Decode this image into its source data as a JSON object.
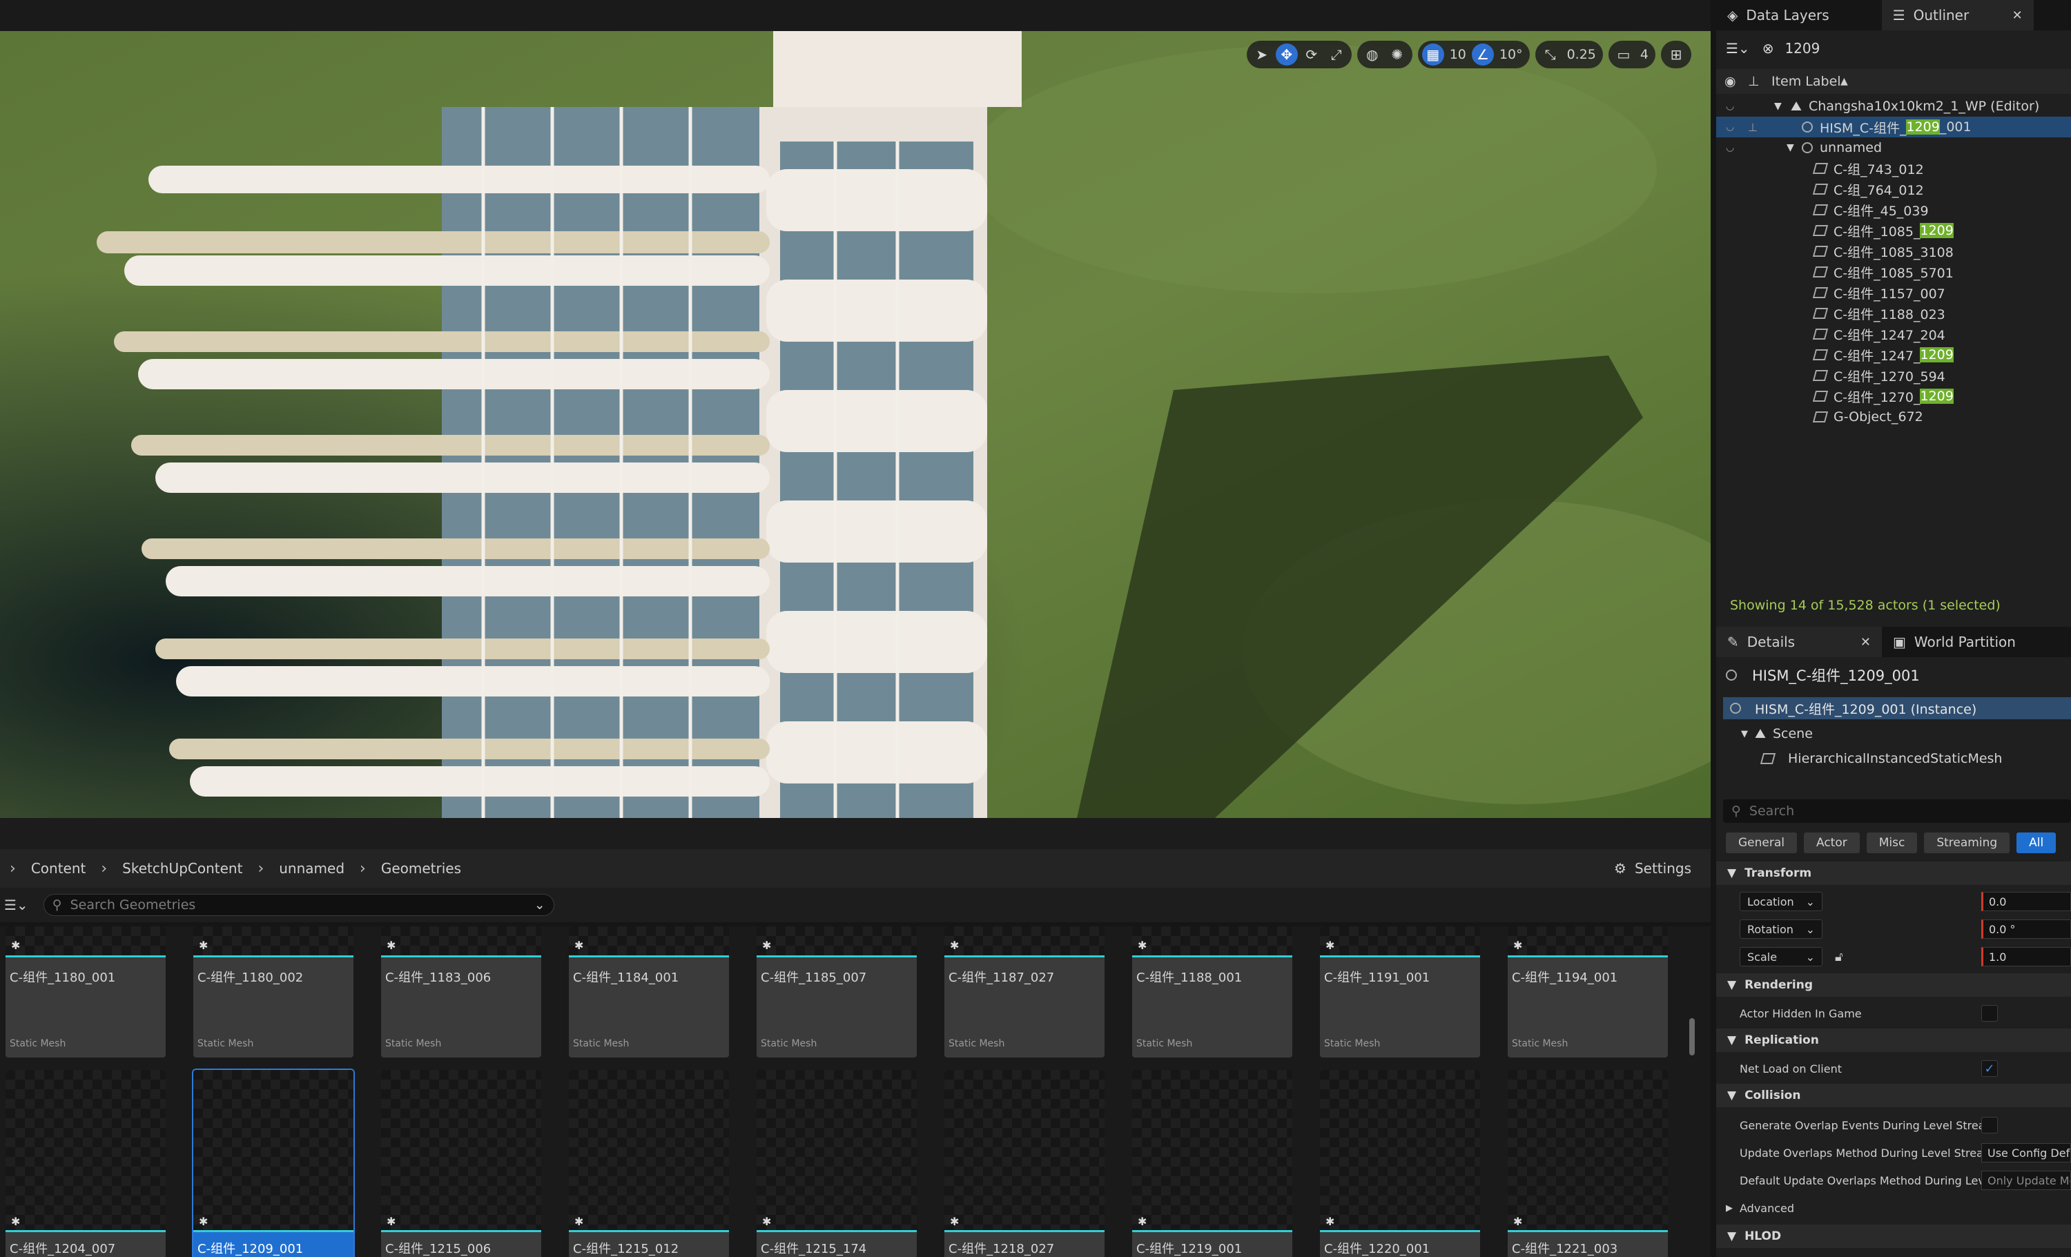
{
  "viewport": {
    "toolbar": {
      "grid_snap_value": "10",
      "rotation_snap_value": "10°",
      "scale_snap_value": "0.25",
      "camera_speed_value": "4"
    }
  },
  "content_browser": {
    "breadcrumb": [
      "Content",
      "SketchUpContent",
      "unnamed",
      "Geometries"
    ],
    "settings_label": "Settings",
    "search_placeholder": "Search Geometries",
    "row1": [
      {
        "name": "C-组件_1180_001",
        "type": "Static Mesh"
      },
      {
        "name": "C-组件_1180_002",
        "type": "Static Mesh"
      },
      {
        "name": "C-组件_1183_006",
        "type": "Static Mesh"
      },
      {
        "name": "C-组件_1184_001",
        "type": "Static Mesh"
      },
      {
        "name": "C-组件_1185_007",
        "type": "Static Mesh"
      },
      {
        "name": "C-组件_1187_027",
        "type": "Static Mesh"
      },
      {
        "name": "C-组件_1188_001",
        "type": "Static Mesh"
      },
      {
        "name": "C-组件_1191_001",
        "type": "Static Mesh"
      },
      {
        "name": "C-组件_1194_001",
        "type": "Static Mesh"
      }
    ],
    "row2": [
      {
        "name": "C-组件_1204_007"
      },
      {
        "name": "C-组件_1209_001"
      },
      {
        "name": "C-组件_1215_006"
      },
      {
        "name": "C-组件_1215_012"
      },
      {
        "name": "C-组件_1215_174"
      },
      {
        "name": "C-组件_1218_027"
      },
      {
        "name": "C-组件_1219_001"
      },
      {
        "name": "C-组件_1220_001"
      },
      {
        "name": "C-组件_1221_003"
      }
    ],
    "selected_tile": "C-组件_1209_001"
  },
  "outliner": {
    "tab_data_layers": "Data Layers",
    "tab_outliner": "Outliner",
    "search_value": "1209",
    "column_item_label": "Item Label",
    "world": "Changsha10x10km2_1_WP (Editor)",
    "selected_row": {
      "pre": "HISM_C-组件_",
      "hl": "1209",
      "post": "_001"
    },
    "folder": "unnamed",
    "items": [
      {
        "pre": "C-组_743_012",
        "hl": "",
        "post": ""
      },
      {
        "pre": "C-组_764_012",
        "hl": "",
        "post": ""
      },
      {
        "pre": "C-组件_45_039",
        "hl": "",
        "post": ""
      },
      {
        "pre": "C-组件_1085_",
        "hl": "1209",
        "post": ""
      },
      {
        "pre": "C-组件_1085_3108",
        "hl": "",
        "post": ""
      },
      {
        "pre": "C-组件_1085_5701",
        "hl": "",
        "post": ""
      },
      {
        "pre": "C-组件_1157_007",
        "hl": "",
        "post": ""
      },
      {
        "pre": "C-组件_1188_023",
        "hl": "",
        "post": ""
      },
      {
        "pre": "C-组件_1247_204",
        "hl": "",
        "post": ""
      },
      {
        "pre": "C-组件_1247_",
        "hl": "1209",
        "post": ""
      },
      {
        "pre": "C-组件_1270_594",
        "hl": "",
        "post": ""
      },
      {
        "pre": "C-组件_1270_",
        "hl": "1209",
        "post": ""
      },
      {
        "pre": "G-Object_672",
        "hl": "",
        "post": ""
      }
    ],
    "status": "Showing 14 of 15,528 actors (1 selected)"
  },
  "details": {
    "tab_details": "Details",
    "tab_world_partition": "World Partition",
    "actor_title": "HISM_C-组件_1209_001",
    "instance_label": "HISM_C-组件_1209_001 (Instance)",
    "scene_label": "Scene",
    "component_label": "HierarchicalInstancedStaticMesh",
    "search_placeholder": "Search",
    "filters": [
      "General",
      "Actor",
      "Misc",
      "Streaming",
      "All"
    ],
    "active_filter": "All",
    "sections": {
      "transform": "Transform",
      "rendering": "Rendering",
      "replication": "Replication",
      "collision": "Collision",
      "advanced": "Advanced",
      "hlod": "HLOD"
    },
    "transform": {
      "location_label": "Location",
      "location_x": "0.0",
      "rotation_label": "Rotation",
      "rotation_x": "0.0 °",
      "scale_label": "Scale",
      "scale_x": "1.0"
    },
    "rendering": {
      "actor_hidden_label": "Actor Hidden In Game",
      "actor_hidden": false
    },
    "replication": {
      "net_load_label": "Net Load on Client",
      "net_load": true
    },
    "collision": {
      "generate_overlap_label": "Generate Overlap Events During Level Strea...",
      "generate_overlap": false,
      "update_overlap_label": "Update Overlaps Method During Level Strea...",
      "update_overlap_value": "Use Config Default",
      "default_update_label": "Default Update Overlaps Method During Lev...",
      "default_update_value": "Only Update Movable"
    }
  },
  "colors": {
    "accent_blue": "#1f6fd1",
    "search_highlight": "#6fb12c",
    "status_green": "#a7cc58",
    "tile_bar": "#2fd0d8"
  }
}
